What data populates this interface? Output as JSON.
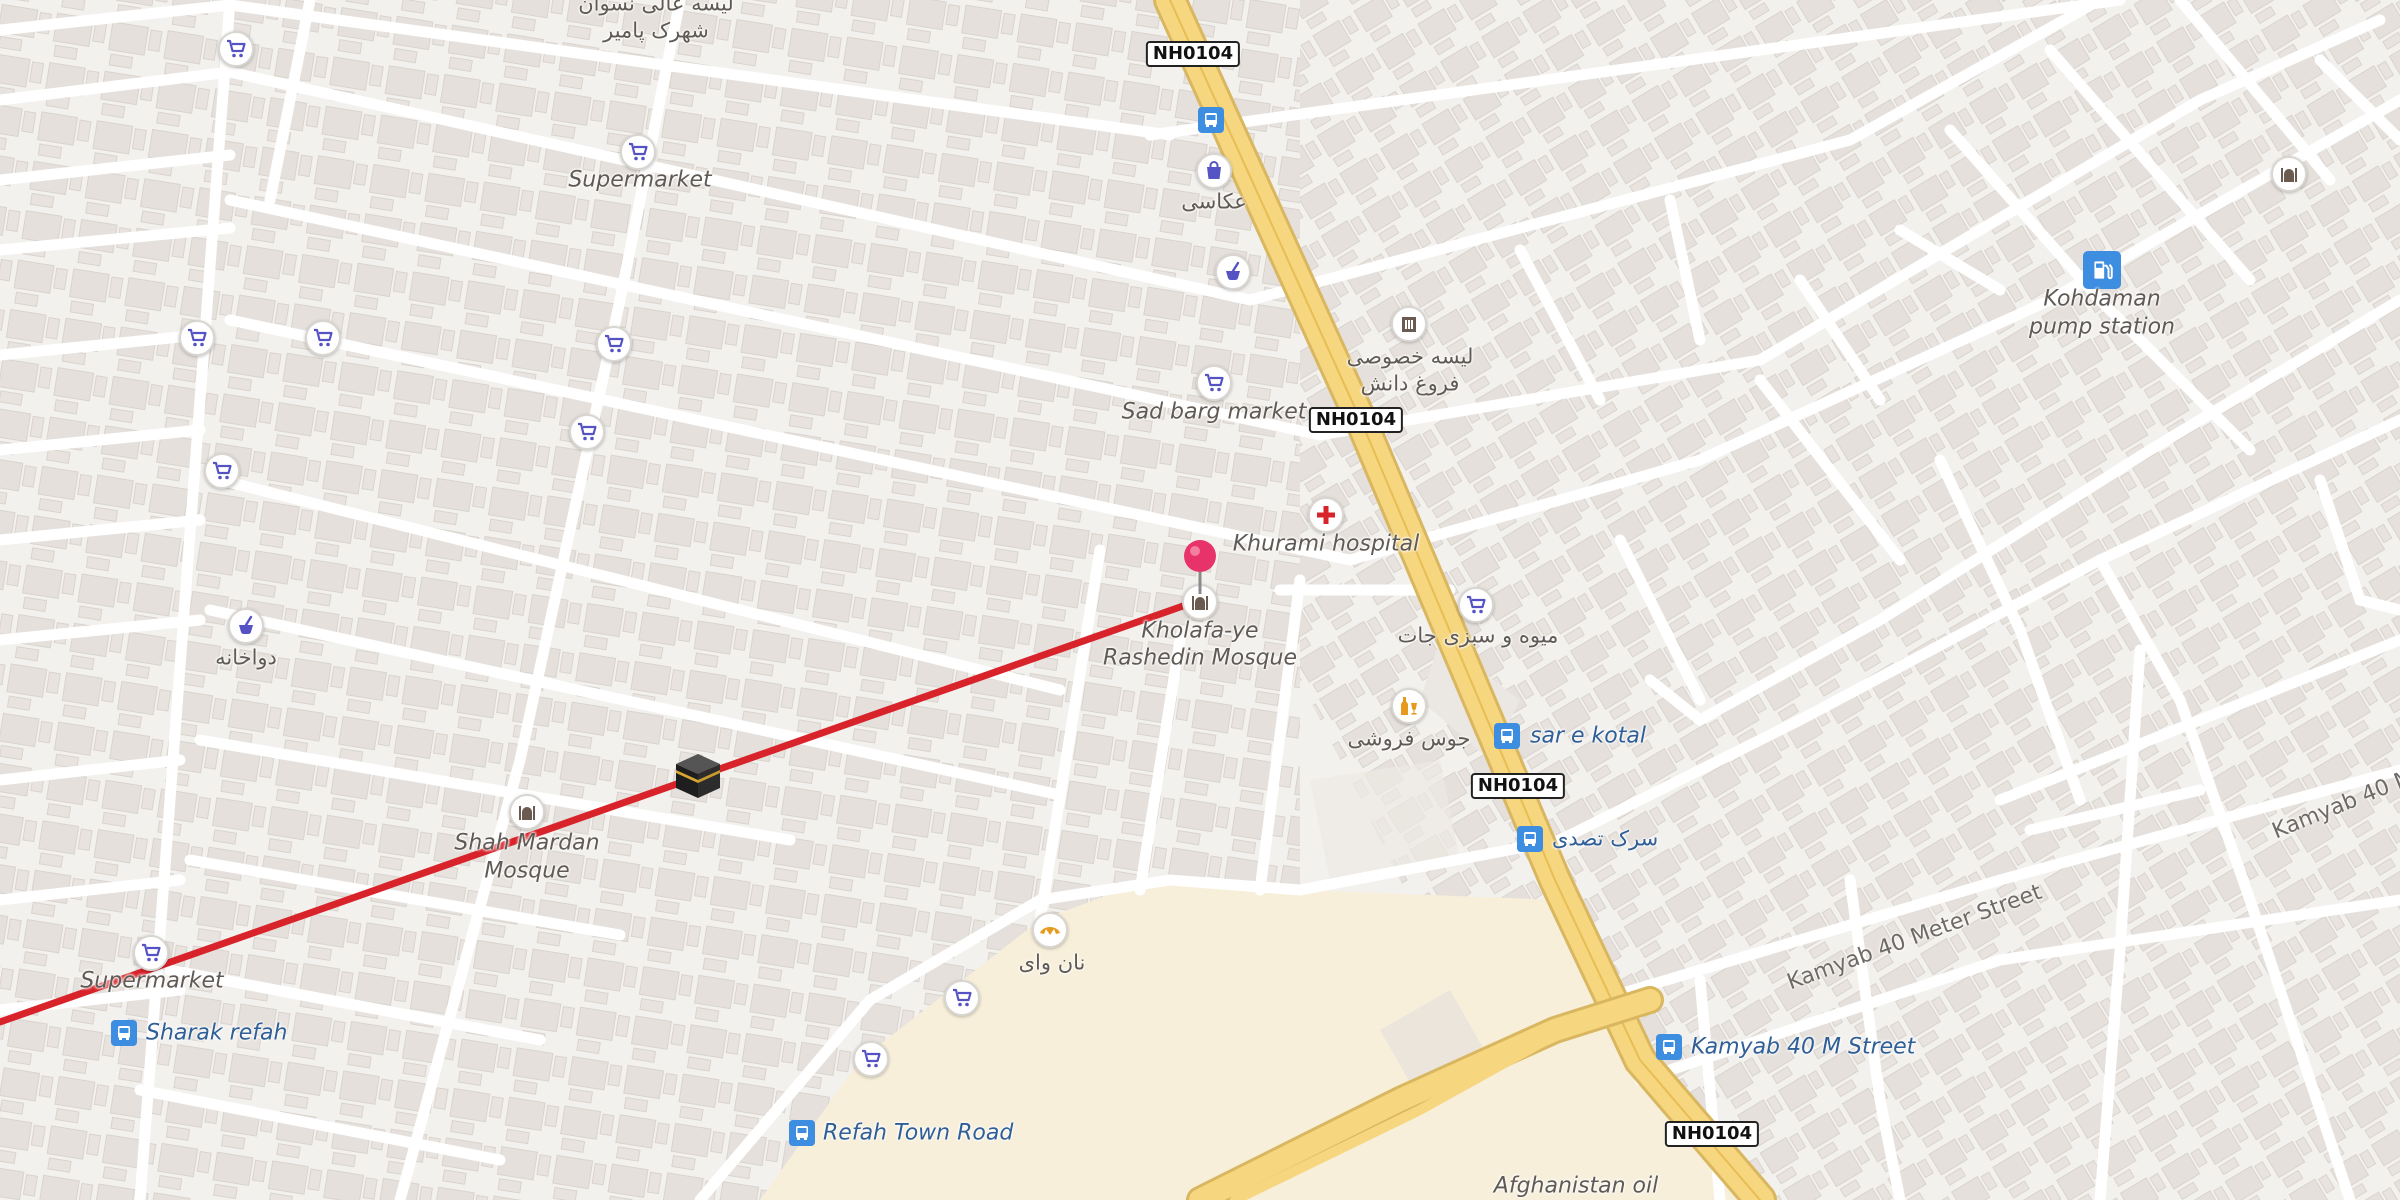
{
  "map": {
    "colors": {
      "background": "#f3f1ee",
      "building": "#e6e1dc",
      "minor_road": "#ffffff",
      "highway": "#f6d67e",
      "route_line": "#d8232a",
      "pin": "#e8336a",
      "sand_area": "#f7efda",
      "poi_icon": "#5553c4"
    },
    "road_shields": [
      "NH0104",
      "NH0104",
      "NH0104",
      "NH0104"
    ],
    "road_names": {
      "kamyab_1": "Kamyab 40 Meter Street",
      "kamyab_2": "Kamyab 40 M"
    },
    "labels": {
      "top_arabic_1": "لیسه عالی نسوان",
      "top_arabic_2": "شهرک پامیر",
      "supermarket_top": "Supermarket",
      "akasi": "عکاسی",
      "school_1": "لیسه خصوصی",
      "school_2": "فروغ دانش",
      "sad_barg": "Sad barg market",
      "khurami": "Khurami hospital",
      "mosque_1": "Kholafa-ye",
      "mosque_2": "Rashedin Mosque",
      "fruit_shop": "میوه و سبزی جات",
      "drinks_shop": "جوس فروشی",
      "sar_e_kotal": "sar e kotal",
      "pharmacy": "دواخانه",
      "shah_mardan_1": "Shah Mardan",
      "shah_mardan_2": "Mosque",
      "supermarket_bottom": "Supermarket",
      "sharak_refah": "Sharak refah",
      "nan_wai": "نان وای",
      "refah_town_road": "Refah Town Road",
      "sarak_tasdi": "سرک تصدی",
      "kamyab_40m_street": "Kamyab 40 M Street",
      "kohdaman_1": "Kohdaman",
      "kohdaman_2": "pump station",
      "afghanistan_oil": "Afghanistan oil"
    },
    "icons": {
      "supermarket": "shopping-cart-icon",
      "shop": "shopping-bag-icon",
      "pharmacy": "mortar-pestle-icon",
      "school": "school-icon",
      "hospital": "red-cross-icon",
      "mosque": "mosque-icon",
      "bakery": "croissant-icon",
      "drinks": "bottle-glass-icon",
      "bus_stop": "bus-stop-icon",
      "fuel": "fuel-pump-icon",
      "kaaba": "kaaba-icon",
      "pin": "location-pin-icon"
    }
  }
}
